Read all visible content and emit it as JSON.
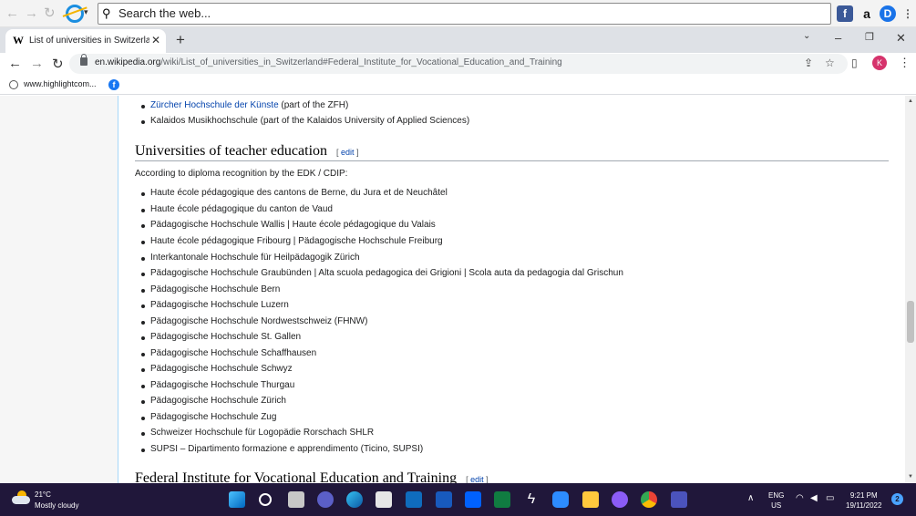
{
  "toolbar": {
    "search_placeholder": "Search the web...",
    "extensions": [
      "facebook-extension",
      "amazon-extension",
      "download-extension"
    ]
  },
  "tab": {
    "favicon": "W",
    "title": "List of universities in Switzerland",
    "new_tab": "+"
  },
  "address": {
    "url_domain": "en.wikipedia.org",
    "url_path": "/wiki/List_of_universities_in_Switzerland#Federal_Institute_for_Vocational_Education_and_Training",
    "profile_initial": "K"
  },
  "bookmarks": {
    "item1": "www.highlightcom..."
  },
  "article": {
    "prev_items": [
      {
        "link": "Zürcher Hochschule der Künste",
        "suffix": " (part of the ZFH)"
      },
      {
        "text": "Kalaidos Musikhochschule (part of the Kalaidos University of Applied Sciences)"
      }
    ],
    "section1": {
      "heading": "Universities of teacher education",
      "edit": "edit",
      "intro": "According to diploma recognition by the EDK / CDIP:",
      "items": [
        "Haute école pédagogique des cantons de Berne, du Jura et de Neuchâtel",
        "Haute école pédagogique du canton de Vaud",
        "Pädagogische Hochschule Wallis | Haute école pédagogique du Valais",
        "Haute école pédagogique Fribourg | Pädagogische Hochschule Freiburg",
        "Interkantonale Hochschule für Heilpädagogik Zürich",
        "Pädagogische Hochschule Graubünden | Alta scuola pedagogica dei Grigioni | Scola auta da pedagogia dal Grischun",
        "Pädagogische Hochschule Bern",
        "Pädagogische Hochschule Luzern",
        "Pädagogische Hochschule Nordwestschweiz (FHNW)",
        "Pädagogische Hochschule St. Gallen",
        "Pädagogische Hochschule Schaffhausen",
        "Pädagogische Hochschule Schwyz",
        "Pädagogische Hochschule Thurgau",
        "Pädagogische Hochschule Zürich",
        "Pädagogische Hochschule Zug",
        "Schweizer Hochschule für Logopädie Rorschach SHLR",
        "SUPSI – Dipartimento formazione e apprendimento (Ticino, SUPSI)"
      ]
    },
    "section2": {
      "heading": "Federal Institute for Vocational Education and Training",
      "edit": "edit"
    }
  },
  "taskbar": {
    "temperature": "21°C",
    "condition": "Mostly cloudy",
    "lang": "ENG",
    "region": "US",
    "time": "9:21 PM",
    "date": "19/11/2022",
    "notifications": "2"
  }
}
